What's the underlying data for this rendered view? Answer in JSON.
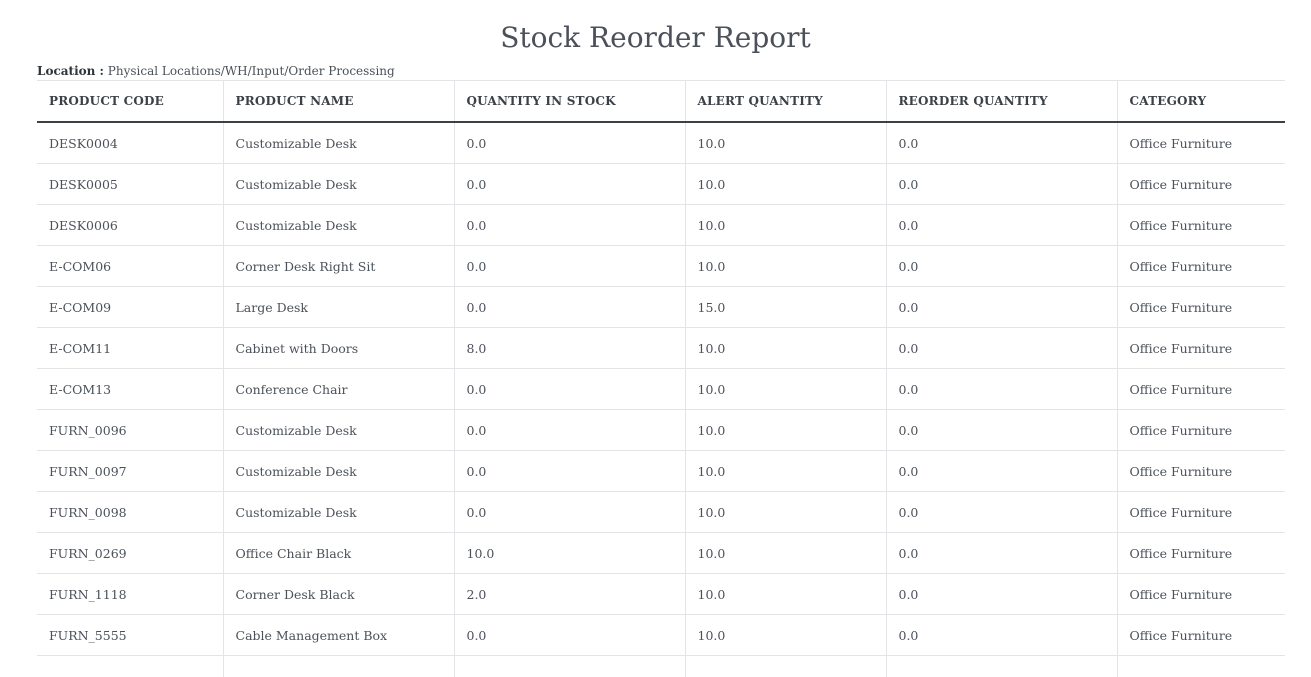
{
  "report": {
    "title": "Stock Reorder Report",
    "location_label": "Location :",
    "location_value": "Physical Locations/WH/Input/Order Processing"
  },
  "table": {
    "headers": [
      "PRODUCT CODE",
      "PRODUCT NAME",
      "QUANTITY IN STOCK",
      "ALERT QUANTITY",
      "REORDER QUANTITY",
      "CATEGORY"
    ],
    "rows": [
      [
        "DESK0004",
        "Customizable Desk",
        "0.0",
        "10.0",
        "0.0",
        "Office Furniture"
      ],
      [
        "DESK0005",
        "Customizable Desk",
        "0.0",
        "10.0",
        "0.0",
        "Office Furniture"
      ],
      [
        "DESK0006",
        "Customizable Desk",
        "0.0",
        "10.0",
        "0.0",
        "Office Furniture"
      ],
      [
        "E-COM06",
        "Corner Desk Right Sit",
        "0.0",
        "10.0",
        "0.0",
        "Office Furniture"
      ],
      [
        "E-COM09",
        "Large Desk",
        "0.0",
        "15.0",
        "0.0",
        "Office Furniture"
      ],
      [
        "E-COM11",
        "Cabinet with Doors",
        "8.0",
        "10.0",
        "0.0",
        "Office Furniture"
      ],
      [
        "E-COM13",
        "Conference Chair",
        "0.0",
        "10.0",
        "0.0",
        "Office Furniture"
      ],
      [
        "FURN_0096",
        "Customizable Desk",
        "0.0",
        "10.0",
        "0.0",
        "Office Furniture"
      ],
      [
        "FURN_0097",
        "Customizable Desk",
        "0.0",
        "10.0",
        "0.0",
        "Office Furniture"
      ],
      [
        "FURN_0098",
        "Customizable Desk",
        "0.0",
        "10.0",
        "0.0",
        "Office Furniture"
      ],
      [
        "FURN_0269",
        "Office Chair Black",
        "10.0",
        "10.0",
        "0.0",
        "Office Furniture"
      ],
      [
        "FURN_1118",
        "Corner Desk Black",
        "2.0",
        "10.0",
        "0.0",
        "Office Furniture"
      ],
      [
        "FURN_5555",
        "Cable Management Box",
        "0.0",
        "10.0",
        "0.0",
        "Office Furniture"
      ],
      [
        "",
        "",
        "",
        "",
        "",
        ""
      ]
    ]
  }
}
